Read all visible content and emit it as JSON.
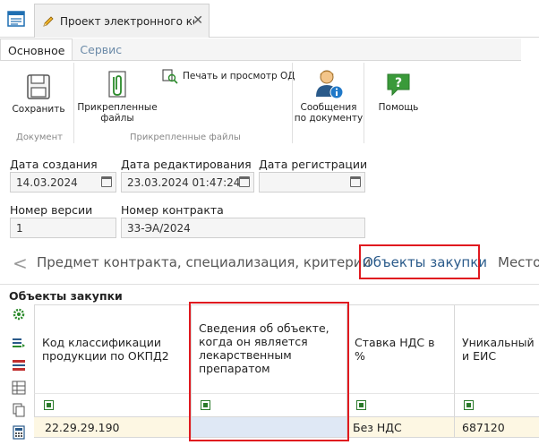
{
  "tabs": {
    "document_title": "Проект электронного ко...",
    "close": "✕"
  },
  "ribbon": {
    "tabs": [
      "Основное",
      "Сервис"
    ],
    "buttons": {
      "save": "Сохранить",
      "attached": "Прикрепленные файлы",
      "print": "Печать и просмотр ОД",
      "messages": "Сообщения по документу",
      "help": "Помощь"
    },
    "groups": {
      "document": "Документ",
      "attached": "Прикрепленные файлы"
    }
  },
  "fields": {
    "created_label": "Дата создания",
    "created_value": "14.03.2024",
    "edited_label": "Дата редактирования",
    "edited_value": "23.03.2024 01:47:24",
    "registered_label": "Дата регистрации",
    "registered_value": "",
    "version_label": "Номер версии",
    "version_value": "1",
    "contract_label": "Номер контракта",
    "contract_value": "33-ЭА/2024"
  },
  "section_tabs": {
    "prev": "<",
    "tab1": "Предмет контракта, специализация, критерии",
    "tab2": "Объекты закупки",
    "tab3": "Место"
  },
  "grid": {
    "title": "Объекты закупки",
    "headers": [
      "Код классификации продукции по ОКПД2",
      "Сведения об объекте, когда он является лекарственным препаратом",
      "Ставка НДС в %",
      "Уникальный и ЕИС"
    ],
    "row": [
      "22.29.29.190",
      "",
      "Без НДС",
      "687120"
    ]
  },
  "colors": {
    "highlight": "#e0191f",
    "row_bg": "#fdf7e3",
    "link": "#2a5a8a"
  }
}
